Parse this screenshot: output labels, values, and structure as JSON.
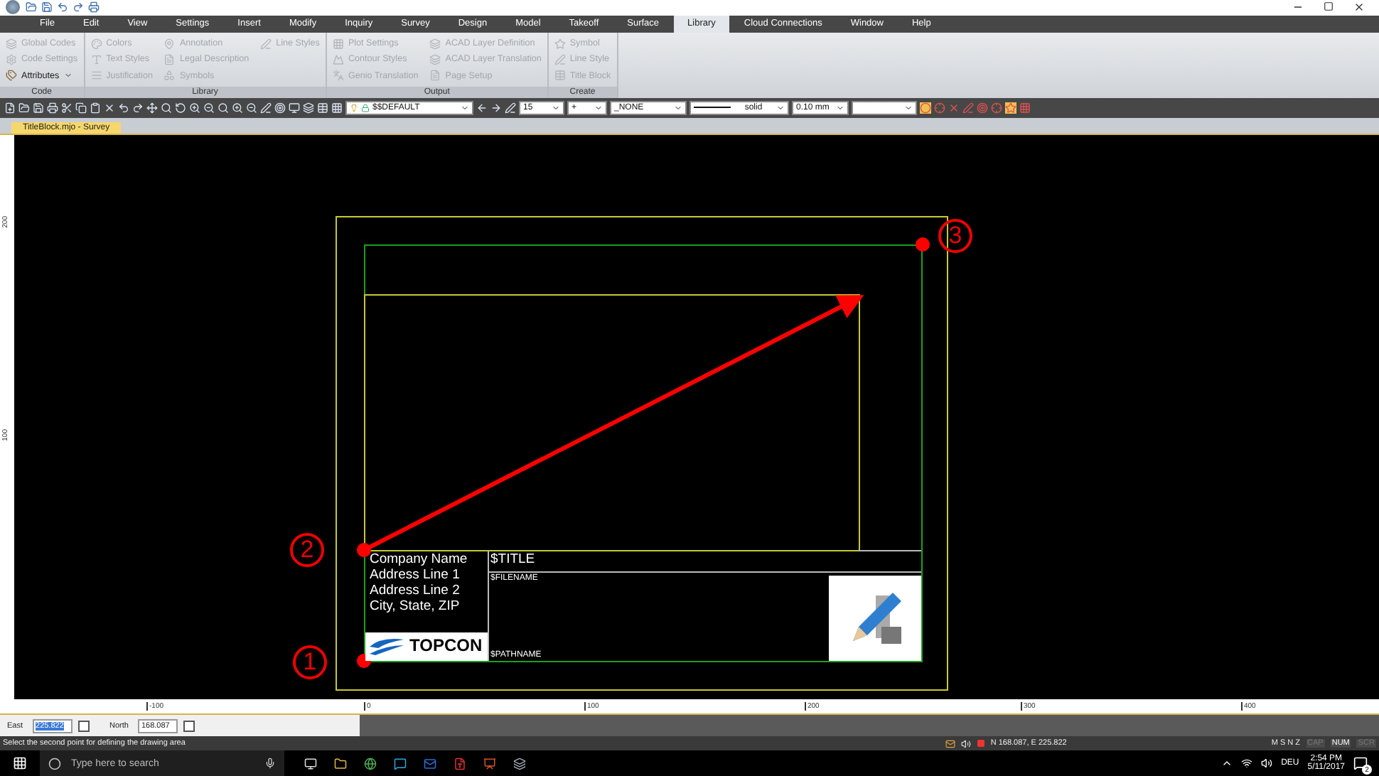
{
  "menu": [
    {
      "label": "File",
      "selected": false
    },
    {
      "label": "Edit",
      "selected": false
    },
    {
      "label": "View",
      "selected": false
    },
    {
      "label": "Settings",
      "selected": false
    },
    {
      "label": "Insert",
      "selected": false
    },
    {
      "label": "Modify",
      "selected": false
    },
    {
      "label": "Inquiry",
      "selected": false
    },
    {
      "label": "Survey",
      "selected": false
    },
    {
      "label": "Design",
      "selected": false
    },
    {
      "label": "Model",
      "selected": false
    },
    {
      "label": "Takeoff",
      "selected": false
    },
    {
      "label": "Surface",
      "selected": false
    },
    {
      "label": "Library",
      "selected": true
    },
    {
      "label": "Cloud Connections",
      "selected": false
    },
    {
      "label": "Window",
      "selected": false
    },
    {
      "label": "Help",
      "selected": false
    }
  ],
  "ribbon_groups": [
    {
      "title": "Code",
      "items": [
        {
          "label": "Global Codes",
          "disabled": true,
          "dropdown": false
        },
        {
          "label": "Code Settings",
          "disabled": true,
          "dropdown": false
        },
        {
          "label": "Attributes",
          "disabled": false,
          "dropdown": true
        }
      ]
    },
    {
      "title": "Library",
      "items": [
        {
          "label": "Colors",
          "disabled": true,
          "dropdown": false
        },
        {
          "label": "Text Styles",
          "disabled": true,
          "dropdown": false
        },
        {
          "label": "Justification",
          "disabled": true,
          "dropdown": false
        },
        {
          "label": "Annotation",
          "disabled": true,
          "dropdown": false
        },
        {
          "label": "Legal Description",
          "disabled": true,
          "dropdown": false
        },
        {
          "label": "Symbols",
          "disabled": true,
          "dropdown": false
        },
        {
          "label": "Line Styles",
          "disabled": true,
          "dropdown": false
        }
      ]
    },
    {
      "title": "Output",
      "items": [
        {
          "label": "Plot Settings",
          "disabled": true,
          "dropdown": false
        },
        {
          "label": "Contour Styles",
          "disabled": true,
          "dropdown": false
        },
        {
          "label": "Genio Translation",
          "disabled": true,
          "dropdown": false
        },
        {
          "label": "ACAD Layer Definition",
          "disabled": true,
          "dropdown": false
        },
        {
          "label": "ACAD Layer Translation",
          "disabled": true,
          "dropdown": false
        },
        {
          "label": "Page Setup",
          "disabled": true,
          "dropdown": false
        }
      ]
    },
    {
      "title": "Create",
      "items": [
        {
          "label": "Symbol",
          "disabled": true,
          "dropdown": false
        },
        {
          "label": "Line Style",
          "disabled": true,
          "dropdown": false
        },
        {
          "label": "Title Block",
          "disabled": true,
          "dropdown": false
        }
      ]
    }
  ],
  "toolbar": {
    "layer": "$$DEFAULT",
    "text_size": "15",
    "point_symbol": "+",
    "style": "_NONE",
    "linetype": "solid",
    "lineweight": "0.10 mm"
  },
  "document_tab": {
    "label": "TitleBlock.mjo - Survey",
    "selected": true
  },
  "drawing": {
    "company_lines": [
      "Company Name",
      "Address Line 1",
      "Address Line 2",
      "City, State, ZIP"
    ],
    "logo_text": "TOPCON",
    "title": "$TITLE",
    "filename": "$FILENAME",
    "pathname": "$PATHNAME",
    "markers": [
      "1",
      "2",
      "3"
    ]
  },
  "rulers": {
    "vertical": [
      "200",
      "100"
    ],
    "horizontal": [
      "-100",
      "0",
      "100",
      "200",
      "300",
      "400"
    ]
  },
  "coordinates": {
    "east_label": "East",
    "east_value": "225.822",
    "east_checked": false,
    "north_label": "North",
    "north_value": "168.087",
    "north_checked": false
  },
  "status_bar": {
    "prompt": "Select the second point for defining the drawing area",
    "position": "N 168.087,  E 225.822",
    "snap_modes": "M S N Z",
    "keys": [
      {
        "label": "CAP",
        "on": false
      },
      {
        "label": "NUM",
        "on": true
      },
      {
        "label": "SCR",
        "on": false
      }
    ]
  },
  "taskbar": {
    "search_placeholder": "Type here to search",
    "language": "DEU",
    "time": "2:54 PM",
    "date": "5/11/2017",
    "notifications": "2"
  }
}
